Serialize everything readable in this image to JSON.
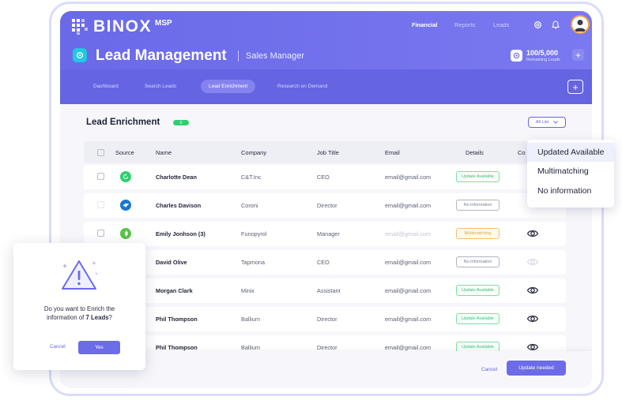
{
  "brand": {
    "name": "BINOX",
    "suffix": "MSP"
  },
  "topnav": [
    "Financial",
    "Reports",
    "Leads"
  ],
  "page": {
    "title": "Lead Management",
    "subtitle": "Sales Manager"
  },
  "credits": {
    "value": "100/5,000",
    "label": "Remaining Leads"
  },
  "tabs": [
    "Dashboard",
    "Search Leads",
    "Lead Enrichment",
    "Research on Demand"
  ],
  "active_tab": "Lead Enrichment",
  "section": {
    "title": "Lead Enrichment",
    "badge": "0",
    "filter": "All List"
  },
  "table": {
    "headers": [
      "Source",
      "Name",
      "Company",
      "Job Title",
      "Email",
      "Details",
      "Co"
    ],
    "rows": [
      {
        "name": "Charlotte Dean",
        "company": "C&T.Inc",
        "title": "CEO",
        "email": "email@gmail.com",
        "details": "Update Available",
        "source_icon": "refresh-icon"
      },
      {
        "name": "Charles Davison",
        "company": "Coroni",
        "title": "Director",
        "email": "email@gmail.com",
        "details": "No information",
        "source_icon": "bird-icon"
      },
      {
        "name": "Emily Jonhson (3)",
        "company": "Funopyrol",
        "title": "Manager",
        "email": "email@gmail.com",
        "details": "Multimatching",
        "source_icon": "leaf-icon"
      },
      {
        "name": "David Olive",
        "company": "Tapmona",
        "title": "CEO",
        "email": "email@gmail.com",
        "details": "No information"
      },
      {
        "name": "Morgan Clark",
        "company": "Minix",
        "title": "Assistant",
        "email": "email@gmail.com",
        "details": "Update Available"
      },
      {
        "name": "Phil Thompson",
        "company": "Ballium",
        "title": "Director",
        "email": "email@gmail.com",
        "details": "Update Available"
      },
      {
        "name": "Phil Thompson",
        "company": "Ballium",
        "title": "Director",
        "email": "email@gmail.com",
        "details": "Update Available"
      }
    ]
  },
  "footer": {
    "cancel": "Cancel",
    "update": "Update needed"
  },
  "dropdown": [
    "Updated Available",
    "Multimatching",
    "No information"
  ],
  "modal": {
    "line1": "Do you want to Enrich the",
    "line2_prefix": "information of ",
    "line2_bold": "7 Leads",
    "line2_suffix": "?",
    "cancel": "Cancel",
    "yes": "Yes"
  },
  "colors": {
    "accent": "#6564e3",
    "green": "#2fcf6f",
    "orange": "#f0a23c"
  }
}
